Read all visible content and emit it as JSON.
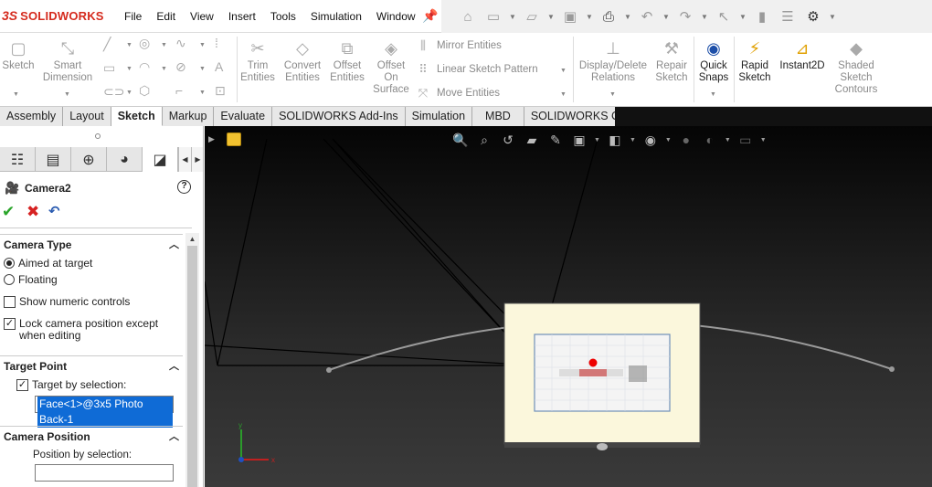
{
  "app": {
    "logo_prefix": "3S",
    "logo_name": "SOLIDWORKS"
  },
  "menu": [
    "File",
    "Edit",
    "View",
    "Insert",
    "Tools",
    "Simulation",
    "Window"
  ],
  "ribbon": {
    "sketch": "Sketch",
    "smart_dimension": "Smart\nDimension",
    "trim_entities": "Trim\nEntities",
    "convert_entities": "Convert\nEntities",
    "offset_entities": "Offset\nEntities",
    "offset_on_surface": "Offset\nOn\nSurface",
    "mirror_entities": "Mirror Entities",
    "linear_sketch_pattern": "Linear Sketch Pattern",
    "move_entities": "Move Entities",
    "display_delete_relations": "Display/Delete\nRelations",
    "repair_sketch": "Repair\nSketch",
    "quick_snaps": "Quick\nSnaps",
    "rapid_sketch": "Rapid\nSketch",
    "instant2d": "Instant2D",
    "shaded_sketch_contours": "Shaded\nSketch\nContours"
  },
  "tabs": [
    {
      "label": "Assembly",
      "active": false
    },
    {
      "label": "Layout",
      "active": false
    },
    {
      "label": "Sketch",
      "active": true
    },
    {
      "label": "Markup",
      "active": false
    },
    {
      "label": "Evaluate",
      "active": false
    },
    {
      "label": "SOLIDWORKS Add-Ins",
      "active": false
    },
    {
      "label": "Simulation",
      "active": false
    },
    {
      "label": "MBD",
      "active": false
    },
    {
      "label": "SOLIDWORKS CAM",
      "active": false
    }
  ],
  "property_manager": {
    "title": "Camera2",
    "help": "?",
    "camera_type": {
      "header": "Camera Type",
      "aimed_at_target": "Aimed at target",
      "floating": "Floating",
      "selected": "aimed",
      "show_numeric_controls": "Show numeric controls",
      "show_numeric_checked": false,
      "lock_camera": "Lock camera position except when editing",
      "lock_camera_checked": true
    },
    "target_point": {
      "header": "Target Point",
      "target_by_selection": "Target by selection:",
      "checked": true,
      "selection_value": "Face<1>@3x5 Photo Back-1"
    },
    "camera_position": {
      "header": "Camera Position",
      "position_by_selection": "Position by selection:",
      "selection_value": ""
    }
  },
  "viewport": {
    "background": "#1a1a1a",
    "axes": {
      "x": "x",
      "y": "y"
    }
  }
}
